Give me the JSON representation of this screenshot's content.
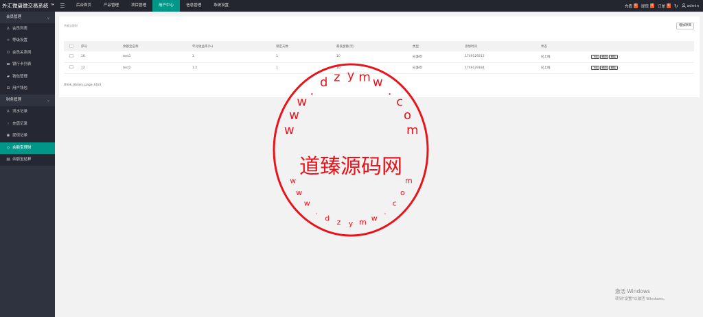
{
  "app": {
    "title": "外汇微盘微交易系统 ™"
  },
  "topnav": {
    "items": [
      "后台首页",
      "产品管理",
      "项目管理",
      "用户中心",
      "信息管理",
      "系统设置"
    ],
    "active_index": 3
  },
  "top_right": {
    "recharge_label": "充值",
    "recharge_count": "0",
    "withdraw_label": "提现",
    "withdraw_count": "0",
    "order_label": "订单",
    "order_count": "0",
    "user_name": "admin"
  },
  "sidebar": {
    "groups": [
      {
        "label": "会员管理",
        "items": [
          "会员列表",
          "等级设置",
          "会员关系网",
          "银行卡列表",
          "钱包管理",
          "用户钱包"
        ]
      },
      {
        "label": "财务管理",
        "items": [
          "流水记录",
          "充值记录",
          "提现记录",
          "余额宝理财",
          "余额宝结算"
        ]
      }
    ],
    "active_item": "余额宝理财"
  },
  "page": {
    "breadcrumb": "余额宝理财",
    "add_button": "增加项目",
    "table": {
      "columns": [
        "序号",
        "余额宝名称",
        "年化收益率(%)",
        "锁定天数",
        "最低金额(元)",
        "类型",
        "添加时间",
        "状态"
      ],
      "rows": [
        {
          "id": "16",
          "name": "test1",
          "rate": "1",
          "days": "1",
          "min": "10",
          "type": "已兼得",
          "time": "1749129212",
          "status": "已上线"
        },
        {
          "id": "12",
          "name": "test2",
          "rate": "1.2",
          "days": "1",
          "min": "10",
          "type": "已兼得",
          "time": "1749129184",
          "status": "已上线"
        }
      ],
      "actions": [
        "下线",
        "修改",
        "删除"
      ]
    },
    "pagination_note": "think_library_page_html"
  },
  "watermark": {
    "center": "道臻源码网",
    "top_arc": "www.dzymw.com",
    "bottom_arc": "www.dzymw.com",
    "color": "#e8141b"
  },
  "os_notice": {
    "title": "激活 Windows",
    "subtitle": "转到\"设置\"以激活 Windows。"
  },
  "colors": {
    "accent": "#009688",
    "topbar": "#23262e",
    "sidebar": "#2f3340",
    "badge": "#ff5722"
  }
}
